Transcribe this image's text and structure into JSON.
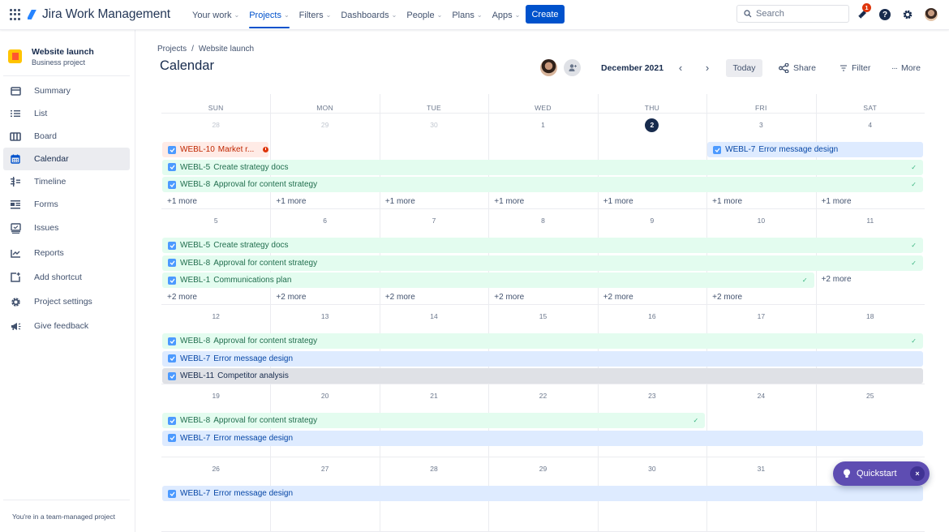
{
  "topnav": {
    "app_name": "Jira Work Management",
    "items": [
      {
        "label": "Your work",
        "active": false
      },
      {
        "label": "Projects",
        "active": true
      },
      {
        "label": "Filters",
        "active": false
      },
      {
        "label": "Dashboards",
        "active": false
      },
      {
        "label": "People",
        "active": false
      },
      {
        "label": "Plans",
        "active": false
      },
      {
        "label": "Apps",
        "active": false
      }
    ],
    "create_label": "Create",
    "search_placeholder": "Search",
    "notification_count": "1",
    "help_glyph": "?",
    "icons": [
      "app-switcher-icon",
      "jira-logo-icon",
      "search-icon",
      "notification-icon",
      "help-icon",
      "settings-icon",
      "profile-avatar"
    ]
  },
  "sidebar": {
    "project_name": "Website launch",
    "project_type": "Business project",
    "items": [
      {
        "label": "Summary",
        "icon": "summary-icon",
        "active": false
      },
      {
        "label": "List",
        "icon": "list-icon",
        "active": false
      },
      {
        "label": "Board",
        "icon": "board-icon",
        "active": false
      },
      {
        "label": "Calendar",
        "icon": "calendar-icon",
        "active": true
      },
      {
        "label": "Timeline",
        "icon": "timeline-icon",
        "active": false
      },
      {
        "label": "Forms",
        "icon": "forms-icon",
        "active": false
      },
      {
        "label": "Issues",
        "icon": "issues-icon",
        "active": false
      },
      {
        "label": "Reports",
        "icon": "reports-icon",
        "active": false
      },
      {
        "label": "Add shortcut",
        "icon": "add-shortcut-icon",
        "active": false
      },
      {
        "label": "Project settings",
        "icon": "settings-icon",
        "active": false
      },
      {
        "label": "Give feedback",
        "icon": "megaphone-icon",
        "active": false
      }
    ],
    "footer": "You're in a team-managed project"
  },
  "header": {
    "breadcrumb": [
      "Projects",
      "Website launch"
    ],
    "breadcrumb_sep": "/",
    "title": "Calendar",
    "month": "December 2021",
    "prev_glyph": "‹",
    "next_glyph": "›",
    "today_label": "Today",
    "share_label": "Share",
    "filter_label": "Filter",
    "more_label": "More"
  },
  "calendar": {
    "weekdays": [
      "SUN",
      "MON",
      "TUE",
      "WED",
      "THU",
      "FRI",
      "SAT"
    ],
    "today": "2",
    "weeks": [
      {
        "days": [
          "28",
          "29",
          "30",
          "1",
          "2",
          "3",
          "4"
        ],
        "muted": [
          true,
          true,
          true,
          false,
          false,
          false,
          false
        ],
        "events": [
          {
            "key": "WEBL-10",
            "title": "Market r...",
            "color": "red",
            "start": 0,
            "span": 1,
            "lane": 0,
            "overdue": true,
            "done": false
          },
          {
            "key": "WEBL-7",
            "title": "Error message design",
            "color": "blue",
            "start": 5,
            "span": 2,
            "lane": 0,
            "done": false
          },
          {
            "key": "WEBL-5",
            "title": "Create strategy docs",
            "color": "green",
            "start": 0,
            "span": 7,
            "lane": 1,
            "done": true
          },
          {
            "key": "WEBL-8",
            "title": "Approval for content strategy",
            "color": "green",
            "start": 0,
            "span": 7,
            "lane": 2,
            "done": true
          }
        ],
        "more": [
          {
            "day": 0,
            "label": "+1 more",
            "lane": 3
          },
          {
            "day": 1,
            "label": "+1 more",
            "lane": 3
          },
          {
            "day": 2,
            "label": "+1 more",
            "lane": 3
          },
          {
            "day": 3,
            "label": "+1 more",
            "lane": 3
          },
          {
            "day": 4,
            "label": "+1 more",
            "lane": 3
          },
          {
            "day": 5,
            "label": "+1 more",
            "lane": 3
          },
          {
            "day": 6,
            "label": "+1 more",
            "lane": 3
          }
        ]
      },
      {
        "days": [
          "5",
          "6",
          "7",
          "8",
          "9",
          "10",
          "11"
        ],
        "muted": [
          false,
          false,
          false,
          false,
          false,
          false,
          false
        ],
        "events": [
          {
            "key": "WEBL-5",
            "title": "Create strategy docs",
            "color": "green",
            "start": 0,
            "span": 7,
            "lane": 0,
            "done": true
          },
          {
            "key": "WEBL-8",
            "title": "Approval for content strategy",
            "color": "green",
            "start": 0,
            "span": 7,
            "lane": 1,
            "done": true
          },
          {
            "key": "WEBL-1",
            "title": "Communications plan",
            "color": "green",
            "start": 0,
            "span": 6,
            "lane": 2,
            "done": true
          }
        ],
        "more": [
          {
            "day": 0,
            "label": "+2 more",
            "lane": 3
          },
          {
            "day": 1,
            "label": "+2 more",
            "lane": 3
          },
          {
            "day": 2,
            "label": "+2 more",
            "lane": 3
          },
          {
            "day": 3,
            "label": "+2 more",
            "lane": 3
          },
          {
            "day": 4,
            "label": "+2 more",
            "lane": 3
          },
          {
            "day": 5,
            "label": "+2 more",
            "lane": 3
          },
          {
            "day": 6,
            "label": "+2 more",
            "lane": 2
          }
        ]
      },
      {
        "days": [
          "12",
          "13",
          "14",
          "15",
          "16",
          "17",
          "18"
        ],
        "muted": [
          false,
          false,
          false,
          false,
          false,
          false,
          false
        ],
        "events": [
          {
            "key": "WEBL-8",
            "title": "Approval for content strategy",
            "color": "green",
            "start": 0,
            "span": 7,
            "lane": 0,
            "done": true
          },
          {
            "key": "WEBL-7",
            "title": "Error message design",
            "color": "blue",
            "start": 0,
            "span": 7,
            "lane": 1,
            "done": false
          },
          {
            "key": "WEBL-11",
            "title": "Competitor analysis",
            "color": "grey",
            "start": 0,
            "span": 7,
            "lane": 2,
            "done": false
          }
        ],
        "more": []
      },
      {
        "days": [
          "19",
          "20",
          "21",
          "22",
          "23",
          "24",
          "25"
        ],
        "muted": [
          false,
          false,
          false,
          false,
          false,
          false,
          false
        ],
        "events": [
          {
            "key": "WEBL-8",
            "title": "Approval for content strategy",
            "color": "green",
            "start": 0,
            "span": 5,
            "lane": 0,
            "done": true
          },
          {
            "key": "WEBL-7",
            "title": "Error message design",
            "color": "blue",
            "start": 0,
            "span": 7,
            "lane": 1,
            "done": false
          }
        ],
        "more": []
      },
      {
        "days": [
          "26",
          "27",
          "28",
          "29",
          "30",
          "31",
          ""
        ],
        "muted": [
          false,
          false,
          false,
          false,
          false,
          false,
          false
        ],
        "events": [
          {
            "key": "WEBL-7",
            "title": "Error message design",
            "color": "blue",
            "start": 0,
            "span": 7,
            "lane": 0,
            "done": false
          }
        ],
        "more": []
      }
    ]
  },
  "quickstart": {
    "label": "Quickstart",
    "close_glyph": "×"
  }
}
